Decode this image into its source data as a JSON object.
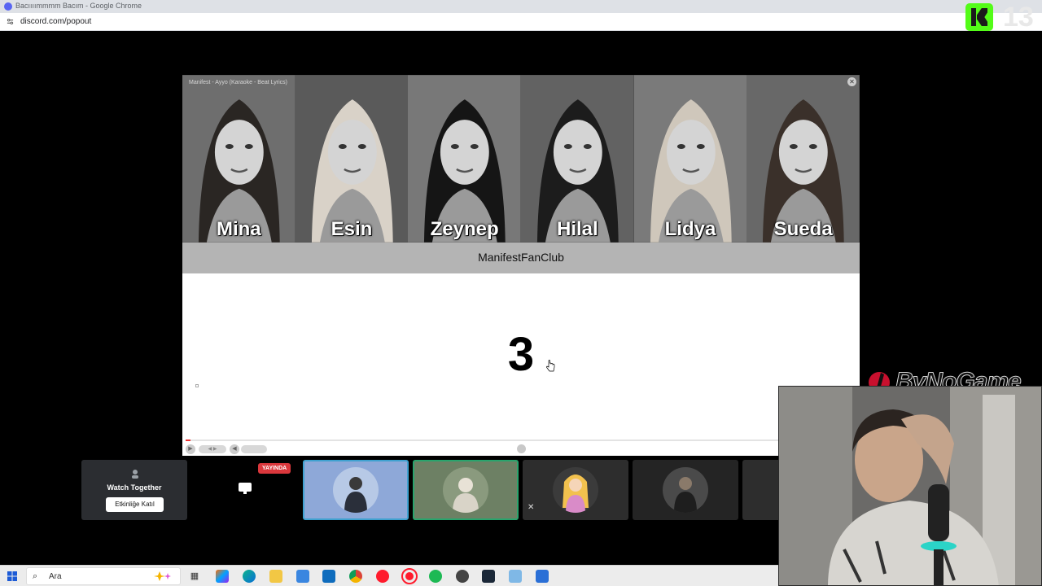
{
  "browser": {
    "window_title": "Bacıııımmmm Bacım - Google Chrome",
    "url": "discord.com/popout"
  },
  "overlay": {
    "kick_count": "13",
    "brand_text": "ByNoGame"
  },
  "player": {
    "video_title": "Manifest - Ayyo (Karaoke - Beat Lyrics)",
    "members": [
      {
        "name": "Mina"
      },
      {
        "name": "Esin"
      },
      {
        "name": "Zeynep"
      },
      {
        "name": "Hilal"
      },
      {
        "name": "Lidya"
      },
      {
        "name": "Sueda"
      }
    ],
    "channel_name": "ManifestFanClub",
    "countdown": "3",
    "progress_fraction": 0.007,
    "scrubber_fraction": 0.5
  },
  "activity": {
    "watch_together_title": "Watch Together",
    "join_button": "Etkinliğe Katıl",
    "live_badge": "YAYINDA"
  },
  "taskbar": {
    "search_label": "Ara"
  },
  "colors": {
    "discord_blurple": "#5865f2",
    "kick_green": "#53fc18",
    "live_red": "#da373c",
    "speaking_green": "#29a46d",
    "focus_blue": "#3fa1d0"
  }
}
